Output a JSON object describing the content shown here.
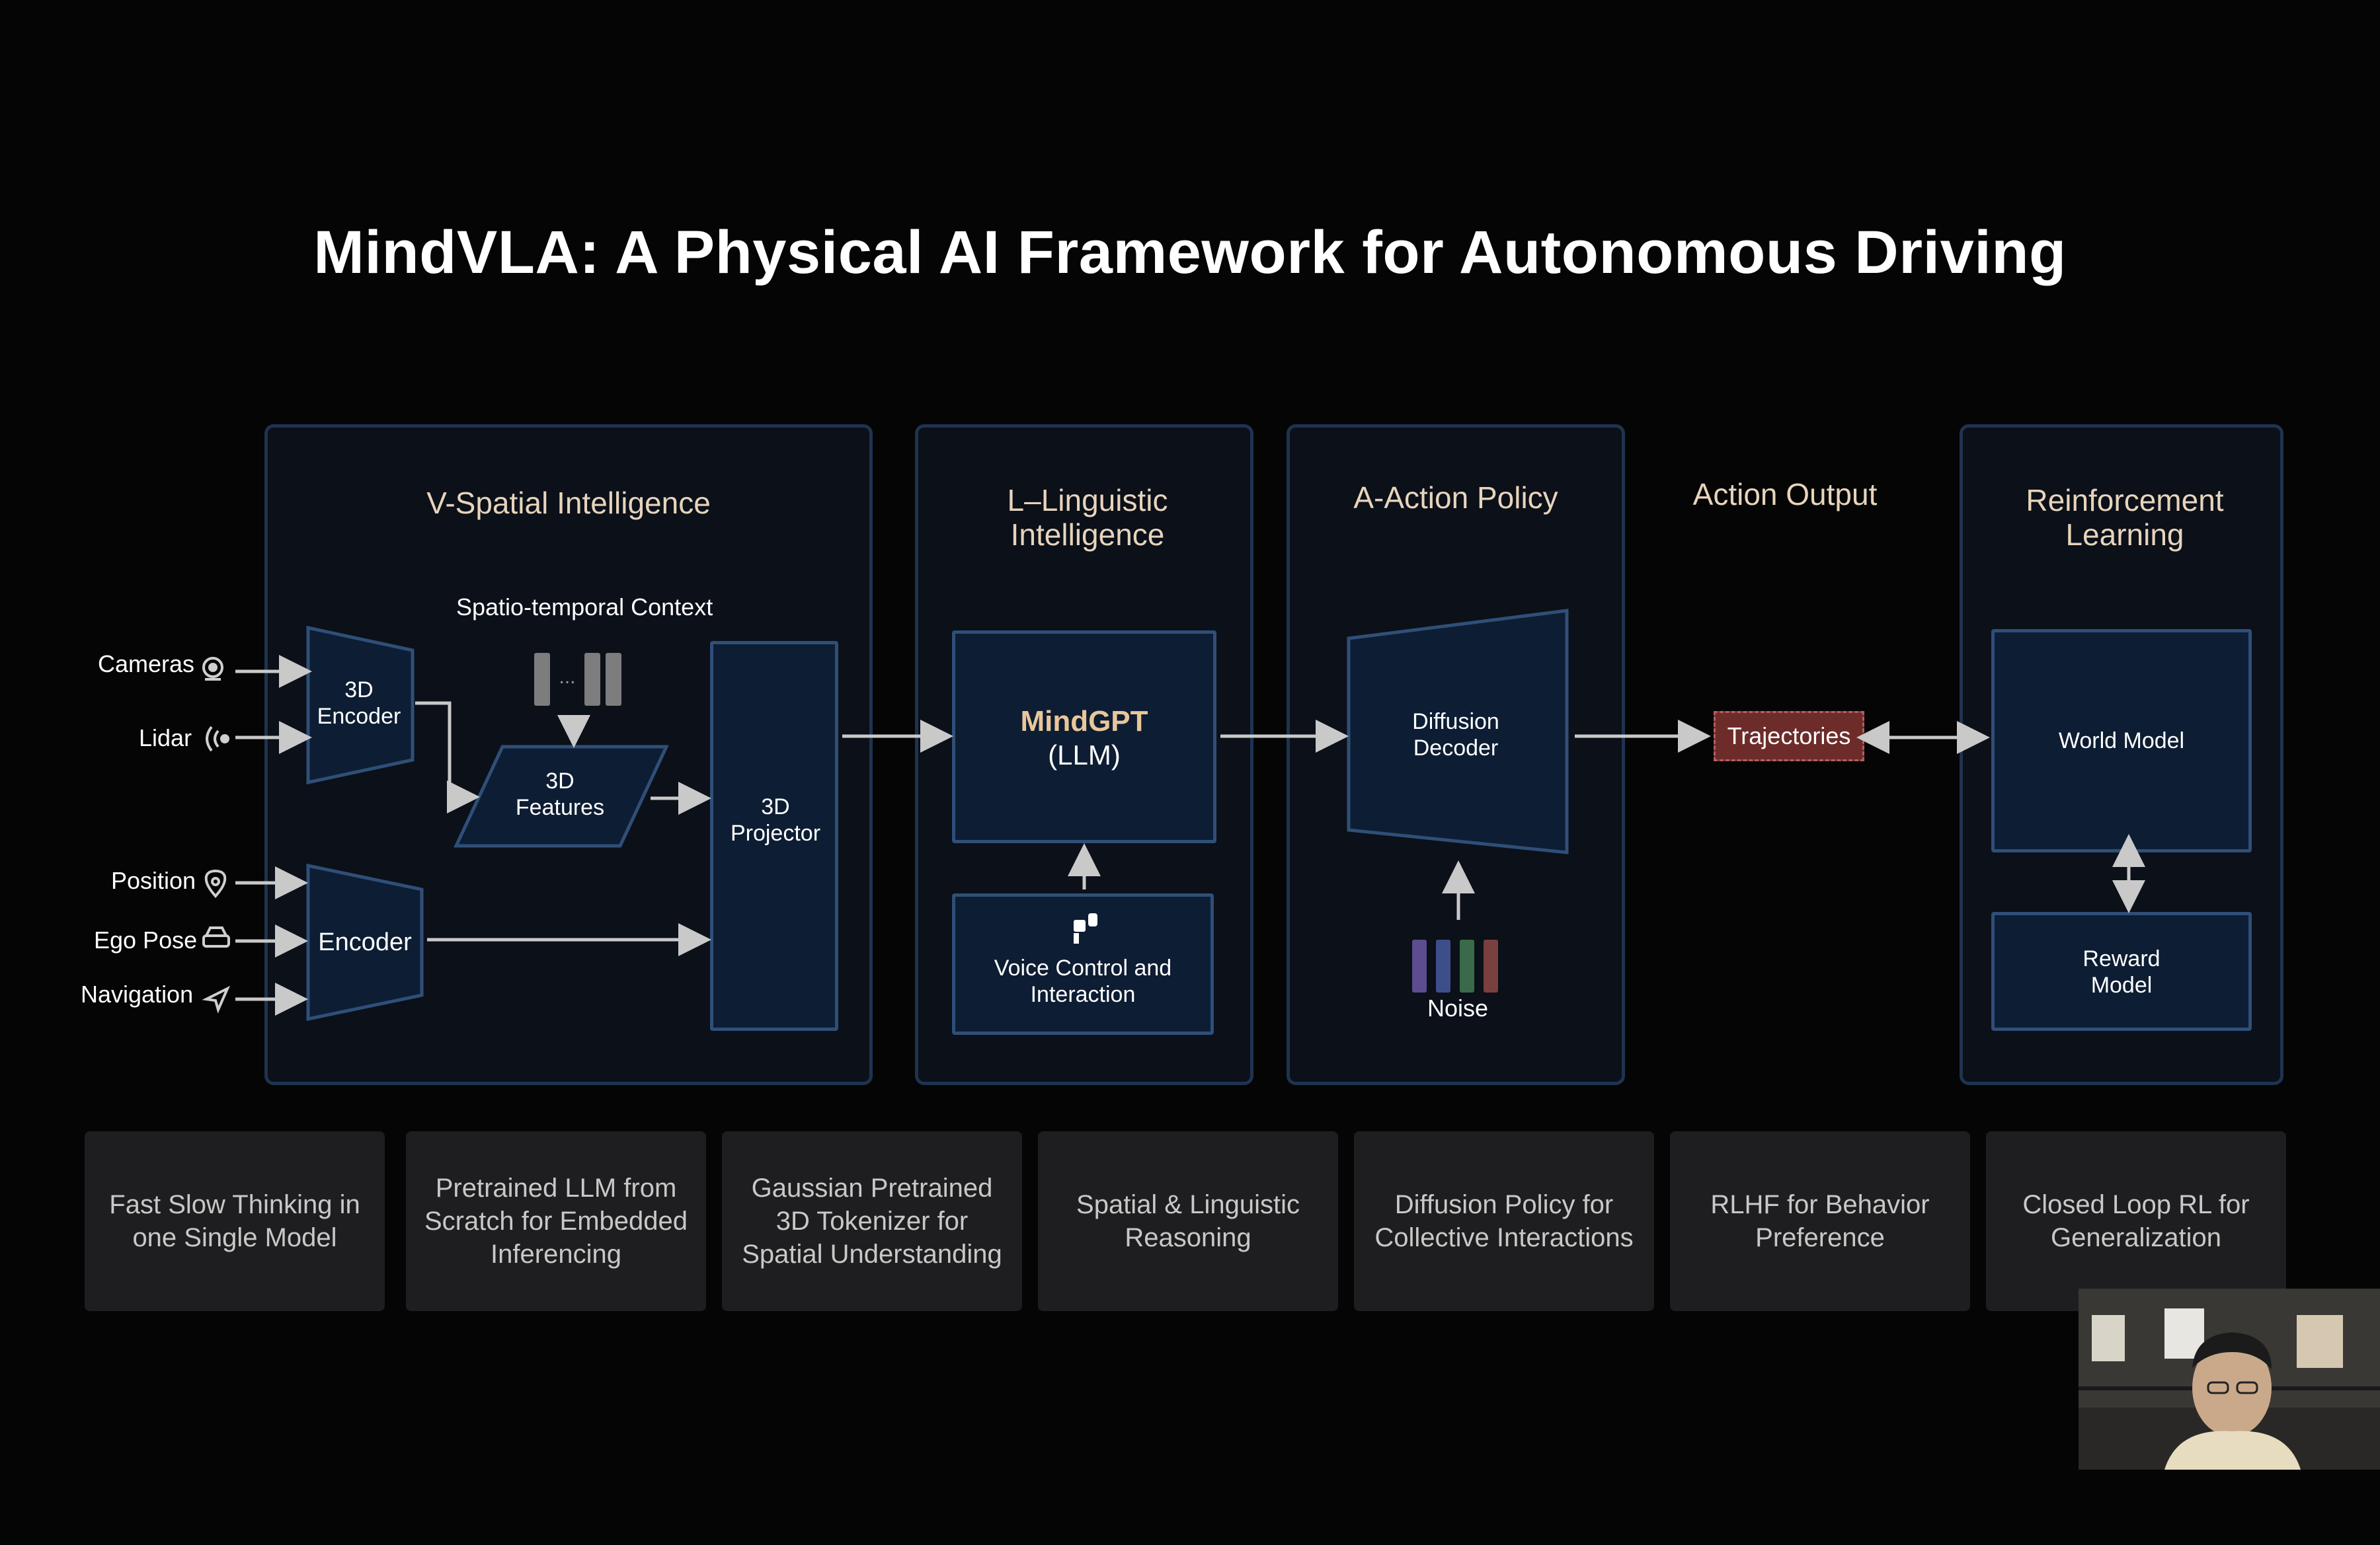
{
  "title": "MindVLA: A Physical AI Framework for Autonomous Driving",
  "panels": {
    "spatial": "V-Spatial Intelligence",
    "linguistic": "L–Linguistic Intelligence",
    "action_policy": "A-Action Policy",
    "action_output": "Action Output",
    "reinforcement": "Reinforcement Learning"
  },
  "inputs": {
    "cameras": "Cameras",
    "lidar": "Lidar",
    "position": "Position",
    "ego_pose": "Ego Pose",
    "navigation": "Navigation"
  },
  "spatial": {
    "context": "Spatio-temporal Context",
    "encoder_3d": "3D Encoder",
    "features_3d": "3D Features",
    "encoder": "Encoder",
    "projector_3d": "3D Projector"
  },
  "linguistic": {
    "mindgpt": "MindGPT",
    "llm": "(LLM)",
    "voice": "Voice Control and Interaction"
  },
  "action": {
    "decoder": "Diffusion Decoder",
    "noise": "Noise",
    "trajectories": "Trajectories"
  },
  "rl": {
    "world_model": "World Model",
    "reward_model": "Reward Model"
  },
  "features": [
    "Fast Slow Thinking in one Single Model",
    "Pretrained LLM from Scratch for Embedded Inferencing",
    "Gaussian Pretrained 3D Tokenizer for Spatial Understanding",
    "Spatial & Linguistic Reasoning",
    "Diffusion Policy for Collective Interactions",
    "RLHF for Behavior Preference",
    "Closed Loop RL for Generalization"
  ],
  "colors": {
    "background": "#050505",
    "panel_border": "#1e3350",
    "box_fill": "#0d1d33",
    "heading": "#e7d4bb",
    "mindgpt": "#e9c79a",
    "trajectories": "#6d2c2a",
    "noise_bars": [
      "#5b4d8f",
      "#3d4f8a",
      "#3a6a4a",
      "#7a3f3f"
    ]
  },
  "icons": [
    "camera-icon",
    "lidar-icon",
    "position-icon",
    "car-icon",
    "navigation-icon",
    "microphone-icon"
  ]
}
